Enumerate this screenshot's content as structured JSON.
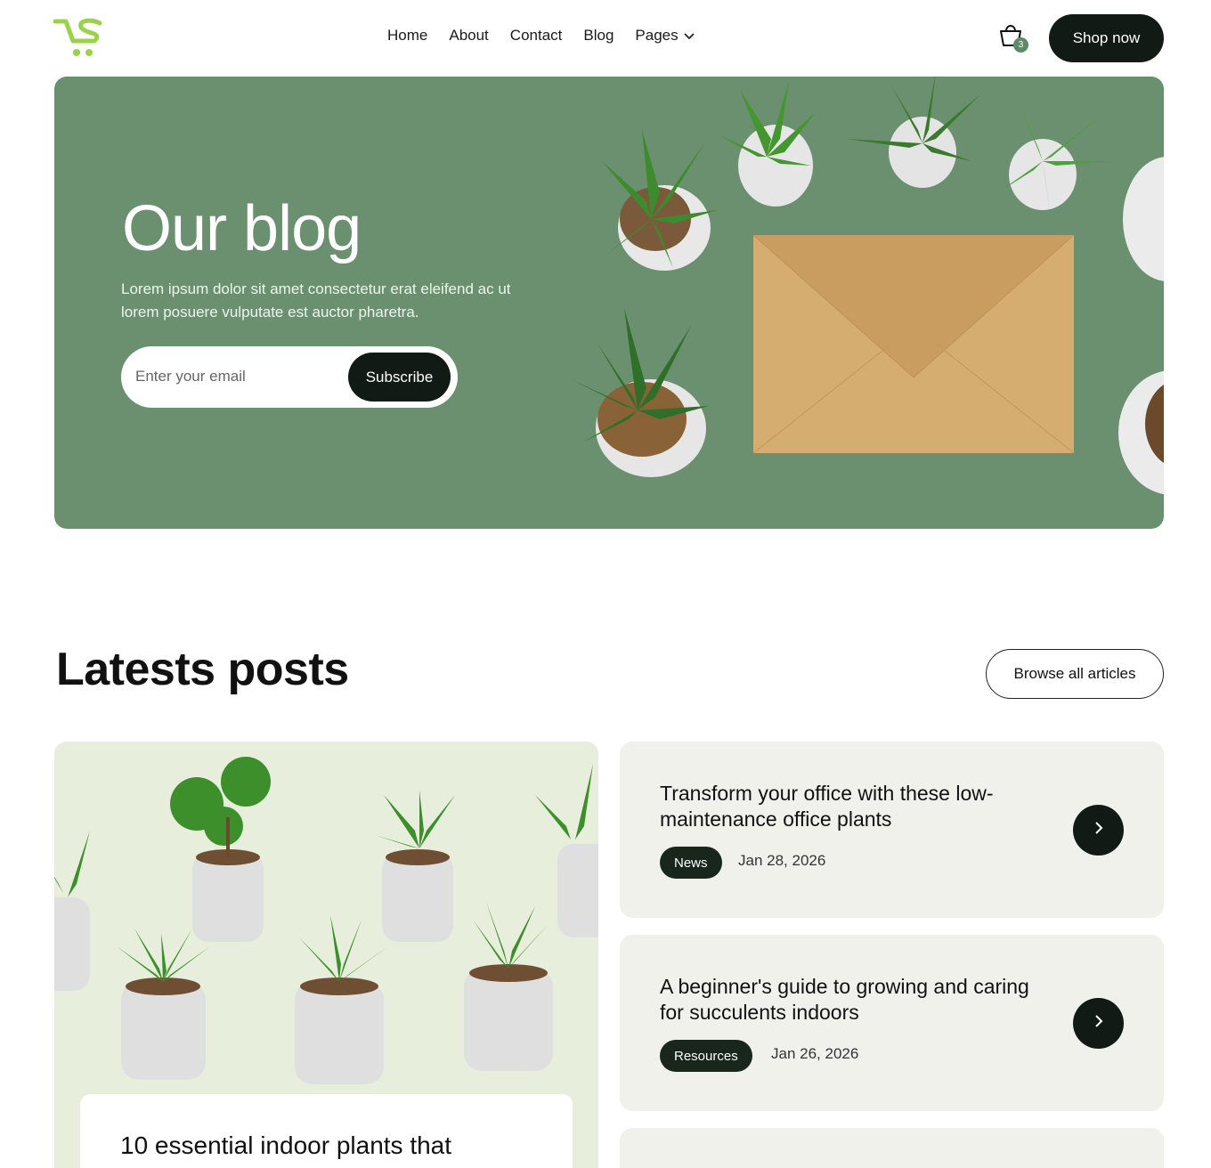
{
  "header": {
    "logo_icon": "cart-logo-icon",
    "nav": [
      {
        "label": "Home"
      },
      {
        "label": "About"
      },
      {
        "label": "Contact"
      },
      {
        "label": "Blog"
      },
      {
        "label": "Pages"
      }
    ],
    "cart_count": "3",
    "shop_label": "Shop now",
    "brand_color": "#9ad24a",
    "dark_color": "#111a14"
  },
  "hero": {
    "title": "Our blog",
    "description": "Lorem ipsum dolor sit amet consectetur erat eleifend ac ut lorem posuere vulputate est auctor pharetra.",
    "email_placeholder": "Enter your email",
    "subscribe_label": "Subscribe",
    "bg_color": "#6b906f"
  },
  "latest": {
    "title": "Latests posts",
    "browse_label": "Browse all articles",
    "featured": {
      "title": "10 essential indoor plants that"
    },
    "posts": [
      {
        "title": "Transform your office with these low-maintenance office plants",
        "tag": "News",
        "date": "Jan 28, 2026"
      },
      {
        "title": "A beginner's  guide to growing and caring for succulents indoors",
        "tag": "Resources",
        "date": "Jan 26, 2026"
      }
    ]
  }
}
